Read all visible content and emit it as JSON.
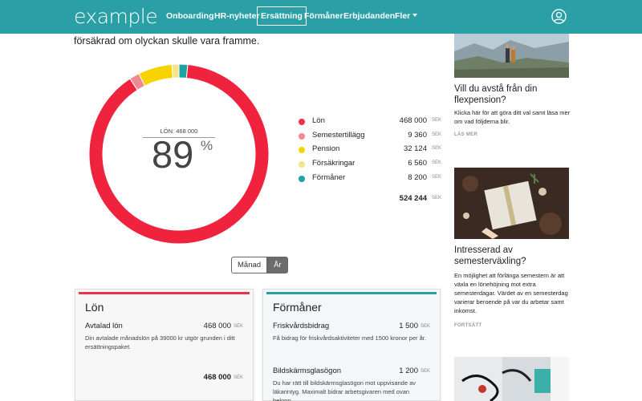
{
  "navbar": {
    "logo": "example",
    "items": [
      "Onboarding",
      "HR-nyheter",
      "Ersättning",
      "Förmåner",
      "Erbjudanden",
      "Fler"
    ],
    "active_item": "Ersättning",
    "background": "#2aa0a6"
  },
  "intro_text": "försäkrad om olyckan skulle vara framme.",
  "donut": {
    "sublabel": "LÖN: 468 000",
    "percent": "89",
    "percent_sign": "%"
  },
  "chart_data": {
    "type": "pie",
    "style": "donut",
    "categories": [
      "Lön",
      "Semestertillägg",
      "Pension",
      "Försäkringar",
      "Förmåner"
    ],
    "values": [
      468000,
      9360,
      32124,
      6560,
      8200
    ],
    "colors": [
      "#f0233f",
      "#f08a90",
      "#f7d400",
      "#f3e48a",
      "#1da3a1"
    ],
    "unit": "SEK",
    "total": 524244,
    "center_label": "LÖN: 468 000",
    "center_value": "89%"
  },
  "legend": {
    "items": [
      {
        "label": "Lön",
        "value": "468 000",
        "unit": "SEK",
        "color": "#e8344c"
      },
      {
        "label": "Semestertillägg",
        "value": "9 360",
        "unit": "SEK",
        "color": "#f08a90"
      },
      {
        "label": "Pension",
        "value": "32 124",
        "unit": "SEK",
        "color": "#f7d400"
      },
      {
        "label": "Försäkringar",
        "value": "6 560",
        "unit": "SEK",
        "color": "#f3e48a"
      },
      {
        "label": "Förmåner",
        "value": "8 200",
        "unit": "SEK",
        "color": "#1da3a1"
      }
    ],
    "total_value": "524 244",
    "total_unit": "SEK"
  },
  "toggle": {
    "options": [
      "Månad",
      "År"
    ],
    "selected": "År"
  },
  "card_lon": {
    "title": "Lön",
    "accent": "#e8344c",
    "item_label": "Avtalad lön",
    "item_value": "468 000",
    "item_unit": "SEK",
    "item_desc": "Din avtalade månadslön på 39000 kr utgör grunden i ditt ersättningspaket.",
    "total_value": "468 000",
    "total_unit": "SEK"
  },
  "card_formaner": {
    "title": "Förmåner",
    "accent": "#2aa0a6",
    "items": [
      {
        "label": "Friskvårdsbidrag",
        "value": "1 500",
        "unit": "SEK",
        "desc": "Få bidrag för friskvårdsaktiviteter med 1500 kronor per år."
      },
      {
        "label": "Bildskärmsglasögon",
        "value": "1 200",
        "unit": "SEK",
        "desc": "Du har rätt till bildskärmsglasögon mot uppvisande av läkarintyg. Maximalt bidrar arbetsgivaren med ovan belopp."
      }
    ]
  },
  "articles": [
    {
      "image": "mountain-couple-photo",
      "title": "Vill du avstå från din flexpension?",
      "body": "Klicka här för att göra ditt val samt läsa mer om vad följderna blir.",
      "link": "LÄS MER"
    },
    {
      "image": "gift-box-photo",
      "title": "Intresserad av semesterväxling?",
      "body": "En möjlighet att förlänga semestern är att växla en lönehöjning mot extra semesterdagar. Värdet av en semesterdag varierar beroende på var du arbetar samt inkomst.",
      "link": "FORTSÄTT"
    },
    {
      "image": "doctor-stethoscope-photo"
    }
  ]
}
